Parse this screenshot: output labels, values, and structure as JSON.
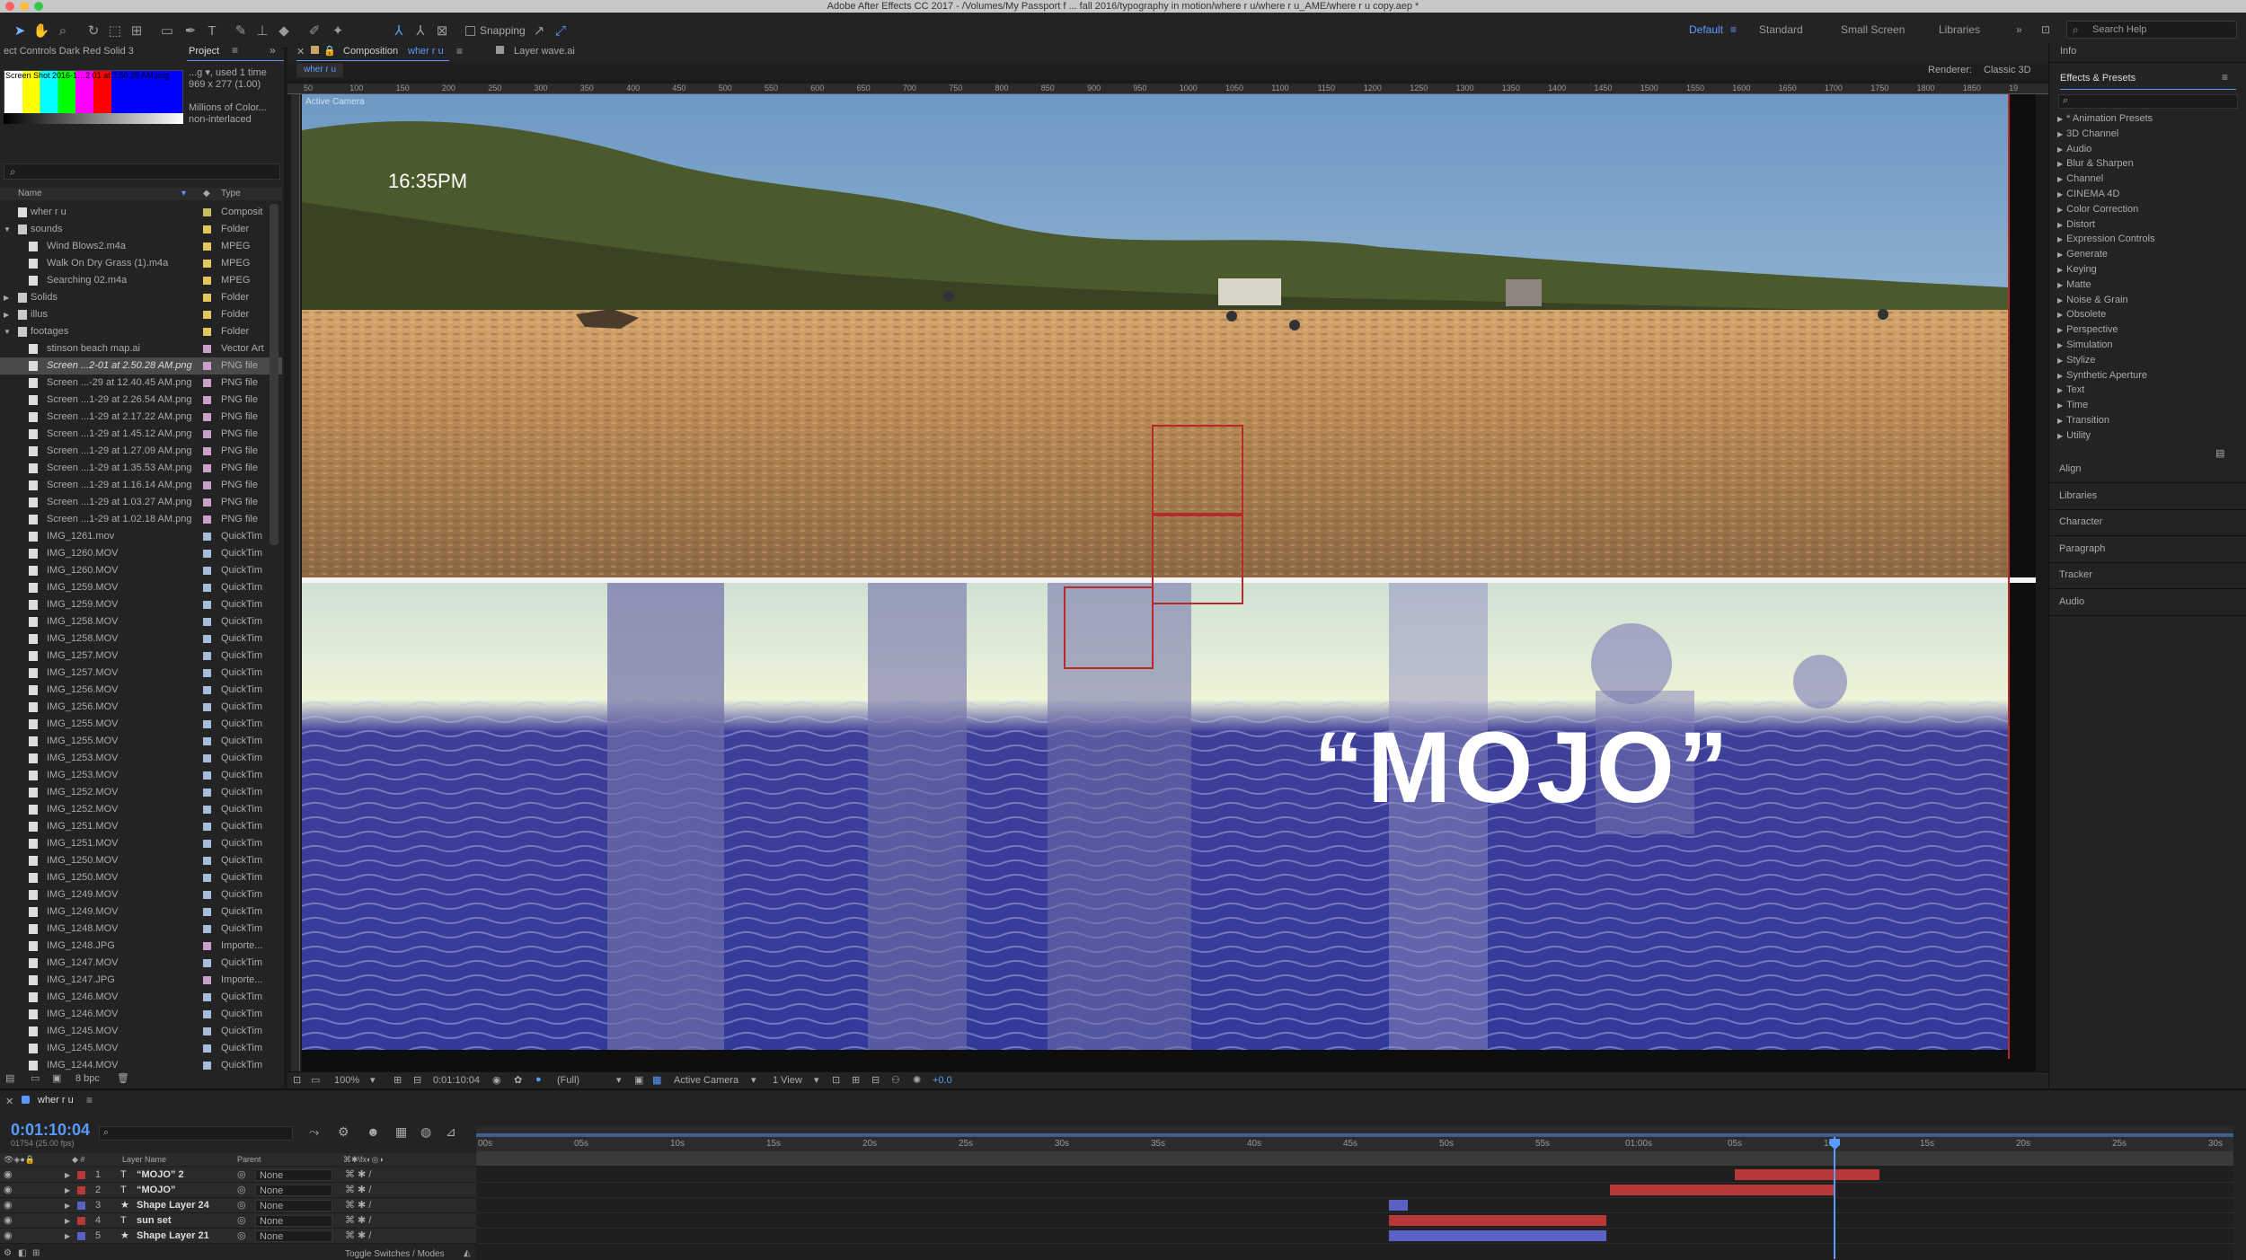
{
  "window": {
    "title": "Adobe After Effects CC 2017 - /Volumes/My Passport f ... fall 2016/typography in motion/where r u/where r u_AME/where r u copy.aep *"
  },
  "toolbar": {
    "snapping_label": "Snapping",
    "workspaces": [
      "Default",
      "Standard",
      "Small Screen",
      "Libraries"
    ],
    "search_placeholder": "Search Help"
  },
  "left_panel": {
    "tab_effects": "ect Controls Dark Red Solid 3",
    "tab_project": "Project",
    "thumb_info": [
      "Screen Shot 2016-1…2 01 at 2.50.28 AM.png",
      "...g ▾, used 1 time",
      "969 x 277 (1.00)",
      "",
      "Millions of Color...",
      "non-interlaced"
    ],
    "col_name": "Name",
    "col_type": "Type",
    "bpc": "8 bpc",
    "items": [
      {
        "name": "wher r u",
        "type": "Composit",
        "label": "#c8c060",
        "indent": 0,
        "arrow": ""
      },
      {
        "name": "sounds",
        "type": "Folder",
        "label": "#e2c75a",
        "indent": 0,
        "arrow": "▼"
      },
      {
        "name": "Wind Blows2.m4a",
        "type": "MPEG",
        "label": "#e2c75a",
        "indent": 1,
        "arrow": ""
      },
      {
        "name": "Walk On Dry Grass (1).m4a",
        "type": "MPEG",
        "label": "#e2c75a",
        "indent": 1,
        "arrow": ""
      },
      {
        "name": "Searching 02.m4a",
        "type": "MPEG",
        "label": "#e2c75a",
        "indent": 1,
        "arrow": ""
      },
      {
        "name": "Solids",
        "type": "Folder",
        "label": "#e2c75a",
        "indent": 0,
        "arrow": "▶"
      },
      {
        "name": "illus",
        "type": "Folder",
        "label": "#e2c75a",
        "indent": 0,
        "arrow": "▶"
      },
      {
        "name": "footages",
        "type": "Folder",
        "label": "#e2c75a",
        "indent": 0,
        "arrow": "▼"
      },
      {
        "name": "stinson beach map.ai",
        "type": "Vector Art",
        "label": "#c9a1c9",
        "indent": 1,
        "arrow": ""
      },
      {
        "name": "Screen ...2-01 at 2.50.28 AM.png",
        "type": "PNG file",
        "label": "#c9a1c9",
        "indent": 1,
        "arrow": "",
        "selected": true
      },
      {
        "name": "Screen ...-29 at 12.40.45 AM.png",
        "type": "PNG file",
        "label": "#c9a1c9",
        "indent": 1,
        "arrow": ""
      },
      {
        "name": "Screen ...1-29 at 2.26.54 AM.png",
        "type": "PNG file",
        "label": "#c9a1c9",
        "indent": 1,
        "arrow": ""
      },
      {
        "name": "Screen ...1-29 at 2.17.22 AM.png",
        "type": "PNG file",
        "label": "#c9a1c9",
        "indent": 1,
        "arrow": ""
      },
      {
        "name": "Screen ...1-29 at 1.45.12 AM.png",
        "type": "PNG file",
        "label": "#c9a1c9",
        "indent": 1,
        "arrow": ""
      },
      {
        "name": "Screen ...1-29 at 1.27.09 AM.png",
        "type": "PNG file",
        "label": "#c9a1c9",
        "indent": 1,
        "arrow": ""
      },
      {
        "name": "Screen ...1-29 at 1.35.53 AM.png",
        "type": "PNG file",
        "label": "#c9a1c9",
        "indent": 1,
        "arrow": ""
      },
      {
        "name": "Screen ...1-29 at 1.16.14 AM.png",
        "type": "PNG file",
        "label": "#c9a1c9",
        "indent": 1,
        "arrow": ""
      },
      {
        "name": "Screen ...1-29 at 1.03.27 AM.png",
        "type": "PNG file",
        "label": "#c9a1c9",
        "indent": 1,
        "arrow": ""
      },
      {
        "name": "Screen ...1-29 at 1.02.18 AM.png",
        "type": "PNG file",
        "label": "#c9a1c9",
        "indent": 1,
        "arrow": ""
      },
      {
        "name": "IMG_1261.mov",
        "type": "QuickTim",
        "label": "#a6bdd9",
        "indent": 1,
        "arrow": ""
      },
      {
        "name": "IMG_1260.MOV",
        "type": "QuickTim",
        "label": "#a6bdd9",
        "indent": 1,
        "arrow": ""
      },
      {
        "name": "IMG_1260.MOV",
        "type": "QuickTim",
        "label": "#a6bdd9",
        "indent": 1,
        "arrow": ""
      },
      {
        "name": "IMG_1259.MOV",
        "type": "QuickTim",
        "label": "#a6bdd9",
        "indent": 1,
        "arrow": ""
      },
      {
        "name": "IMG_1259.MOV",
        "type": "QuickTim",
        "label": "#a6bdd9",
        "indent": 1,
        "arrow": ""
      },
      {
        "name": "IMG_1258.MOV",
        "type": "QuickTim",
        "label": "#a6bdd9",
        "indent": 1,
        "arrow": ""
      },
      {
        "name": "IMG_1258.MOV",
        "type": "QuickTim",
        "label": "#a6bdd9",
        "indent": 1,
        "arrow": ""
      },
      {
        "name": "IMG_1257.MOV",
        "type": "QuickTim",
        "label": "#a6bdd9",
        "indent": 1,
        "arrow": ""
      },
      {
        "name": "IMG_1257.MOV",
        "type": "QuickTim",
        "label": "#a6bdd9",
        "indent": 1,
        "arrow": ""
      },
      {
        "name": "IMG_1256.MOV",
        "type": "QuickTim",
        "label": "#a6bdd9",
        "indent": 1,
        "arrow": ""
      },
      {
        "name": "IMG_1256.MOV",
        "type": "QuickTim",
        "label": "#a6bdd9",
        "indent": 1,
        "arrow": ""
      },
      {
        "name": "IMG_1255.MOV",
        "type": "QuickTim",
        "label": "#a6bdd9",
        "indent": 1,
        "arrow": ""
      },
      {
        "name": "IMG_1255.MOV",
        "type": "QuickTim",
        "label": "#a6bdd9",
        "indent": 1,
        "arrow": ""
      },
      {
        "name": "IMG_1253.MOV",
        "type": "QuickTim",
        "label": "#a6bdd9",
        "indent": 1,
        "arrow": ""
      },
      {
        "name": "IMG_1253.MOV",
        "type": "QuickTim",
        "label": "#a6bdd9",
        "indent": 1,
        "arrow": ""
      },
      {
        "name": "IMG_1252.MOV",
        "type": "QuickTim",
        "label": "#a6bdd9",
        "indent": 1,
        "arrow": ""
      },
      {
        "name": "IMG_1252.MOV",
        "type": "QuickTim",
        "label": "#a6bdd9",
        "indent": 1,
        "arrow": ""
      },
      {
        "name": "IMG_1251.MOV",
        "type": "QuickTim",
        "label": "#a6bdd9",
        "indent": 1,
        "arrow": ""
      },
      {
        "name": "IMG_1251.MOV",
        "type": "QuickTim",
        "label": "#a6bdd9",
        "indent": 1,
        "arrow": ""
      },
      {
        "name": "IMG_1250.MOV",
        "type": "QuickTim",
        "label": "#a6bdd9",
        "indent": 1,
        "arrow": ""
      },
      {
        "name": "IMG_1250.MOV",
        "type": "QuickTim",
        "label": "#a6bdd9",
        "indent": 1,
        "arrow": ""
      },
      {
        "name": "IMG_1249.MOV",
        "type": "QuickTim",
        "label": "#a6bdd9",
        "indent": 1,
        "arrow": ""
      },
      {
        "name": "IMG_1249.MOV",
        "type": "QuickTim",
        "label": "#a6bdd9",
        "indent": 1,
        "arrow": ""
      },
      {
        "name": "IMG_1248.MOV",
        "type": "QuickTim",
        "label": "#a6bdd9",
        "indent": 1,
        "arrow": ""
      },
      {
        "name": "IMG_1248.JPG",
        "type": "Importe...",
        "label": "#c9a1c9",
        "indent": 1,
        "arrow": ""
      },
      {
        "name": "IMG_1247.MOV",
        "type": "QuickTim",
        "label": "#a6bdd9",
        "indent": 1,
        "arrow": ""
      },
      {
        "name": "IMG_1247.JPG",
        "type": "Importe...",
        "label": "#c9a1c9",
        "indent": 1,
        "arrow": ""
      },
      {
        "name": "IMG_1246.MOV",
        "type": "QuickTim",
        "label": "#a6bdd9",
        "indent": 1,
        "arrow": ""
      },
      {
        "name": "IMG_1246.MOV",
        "type": "QuickTim",
        "label": "#a6bdd9",
        "indent": 1,
        "arrow": ""
      },
      {
        "name": "IMG_1245.MOV",
        "type": "QuickTim",
        "label": "#a6bdd9",
        "indent": 1,
        "arrow": ""
      },
      {
        "name": "IMG_1245.MOV",
        "type": "QuickTim",
        "label": "#a6bdd9",
        "indent": 1,
        "arrow": ""
      },
      {
        "name": "IMG_1244.MOV",
        "type": "QuickTim",
        "label": "#a6bdd9",
        "indent": 1,
        "arrow": ""
      }
    ]
  },
  "composition": {
    "tab_label": "Composition",
    "tab_comp_name": "wher r u",
    "tab_layer": "Layer wave.ai",
    "sub_tab": "wher r u",
    "renderer_label": "Renderer:",
    "renderer_value": "Classic 3D",
    "camera_overlay": "Active Camera",
    "time_overlay": "16:35PM",
    "mojo_text": "“MOJO”",
    "ruler_ticks": [
      "50",
      "100",
      "150",
      "200",
      "250",
      "300",
      "350",
      "400",
      "450",
      "500",
      "550",
      "600",
      "650",
      "700",
      "750",
      "800",
      "850",
      "900",
      "950",
      "1000",
      "1050",
      "1100",
      "1150",
      "1200",
      "1250",
      "1300",
      "1350",
      "1400",
      "1450",
      "1500",
      "1550",
      "1600",
      "1650",
      "1700",
      "1750",
      "1800",
      "1850",
      "19"
    ]
  },
  "viewer_bar": {
    "zoom": "100%",
    "timecode": "0:01:10:04",
    "resolution": "(Full)",
    "camera": "Active Camera",
    "views": "1 View",
    "exposure": "+0.0"
  },
  "right_panel": {
    "info": "Info",
    "effects_title": "Effects & Presets",
    "effects": [
      "* Animation Presets",
      "3D Channel",
      "Audio",
      "Blur & Sharpen",
      "Channel",
      "CINEMA 4D",
      "Color Correction",
      "Distort",
      "Expression Controls",
      "Generate",
      "Keying",
      "Matte",
      "Noise & Grain",
      "Obsolete",
      "Perspective",
      "Simulation",
      "Stylize",
      "Synthetic Aperture",
      "Text",
      "Time",
      "Transition",
      "Utility"
    ],
    "panels": [
      "Align",
      "Libraries",
      "Character",
      "Paragraph",
      "Tracker",
      "Audio"
    ]
  },
  "timeline": {
    "tab_name": "wher r u",
    "current_time": "0:01:10:04",
    "frame_info": "01754 (25.00 fps)",
    "col_layer": "Layer Name",
    "col_parent": "Parent",
    "toggle_label": "Toggle Switches / Modes",
    "ticks": [
      "00s",
      "05s",
      "10s",
      "15s",
      "20s",
      "25s",
      "30s",
      "35s",
      "40s",
      "45s",
      "50s",
      "55s",
      "01:00s",
      "05s",
      "10s",
      "15s",
      "20s",
      "25s",
      "30s"
    ],
    "playhead_seconds": 70.16,
    "duration_seconds": 90,
    "layers": [
      {
        "num": "1",
        "kind": "T",
        "name": "“MOJO” 2",
        "parent": "None",
        "color": "#b83838",
        "start": 65.0,
        "end": 72.5
      },
      {
        "num": "2",
        "kind": "T",
        "name": "“MOJO”",
        "parent": "None",
        "color": "#b83838",
        "start": 58.5,
        "end": 70.2
      },
      {
        "num": "3",
        "kind": "★",
        "name": "Shape Layer 24",
        "parent": "None",
        "color": "#5a61c4",
        "start": 47.0,
        "end": 48.0
      },
      {
        "num": "4",
        "kind": "T",
        "name": "sun set",
        "parent": "None",
        "color": "#b83838",
        "start": 47.0,
        "end": 58.3
      },
      {
        "num": "5",
        "kind": "★",
        "name": "Shape Layer 21",
        "parent": "None",
        "color": "#5a61c4",
        "start": 47.0,
        "end": 58.3
      }
    ]
  }
}
